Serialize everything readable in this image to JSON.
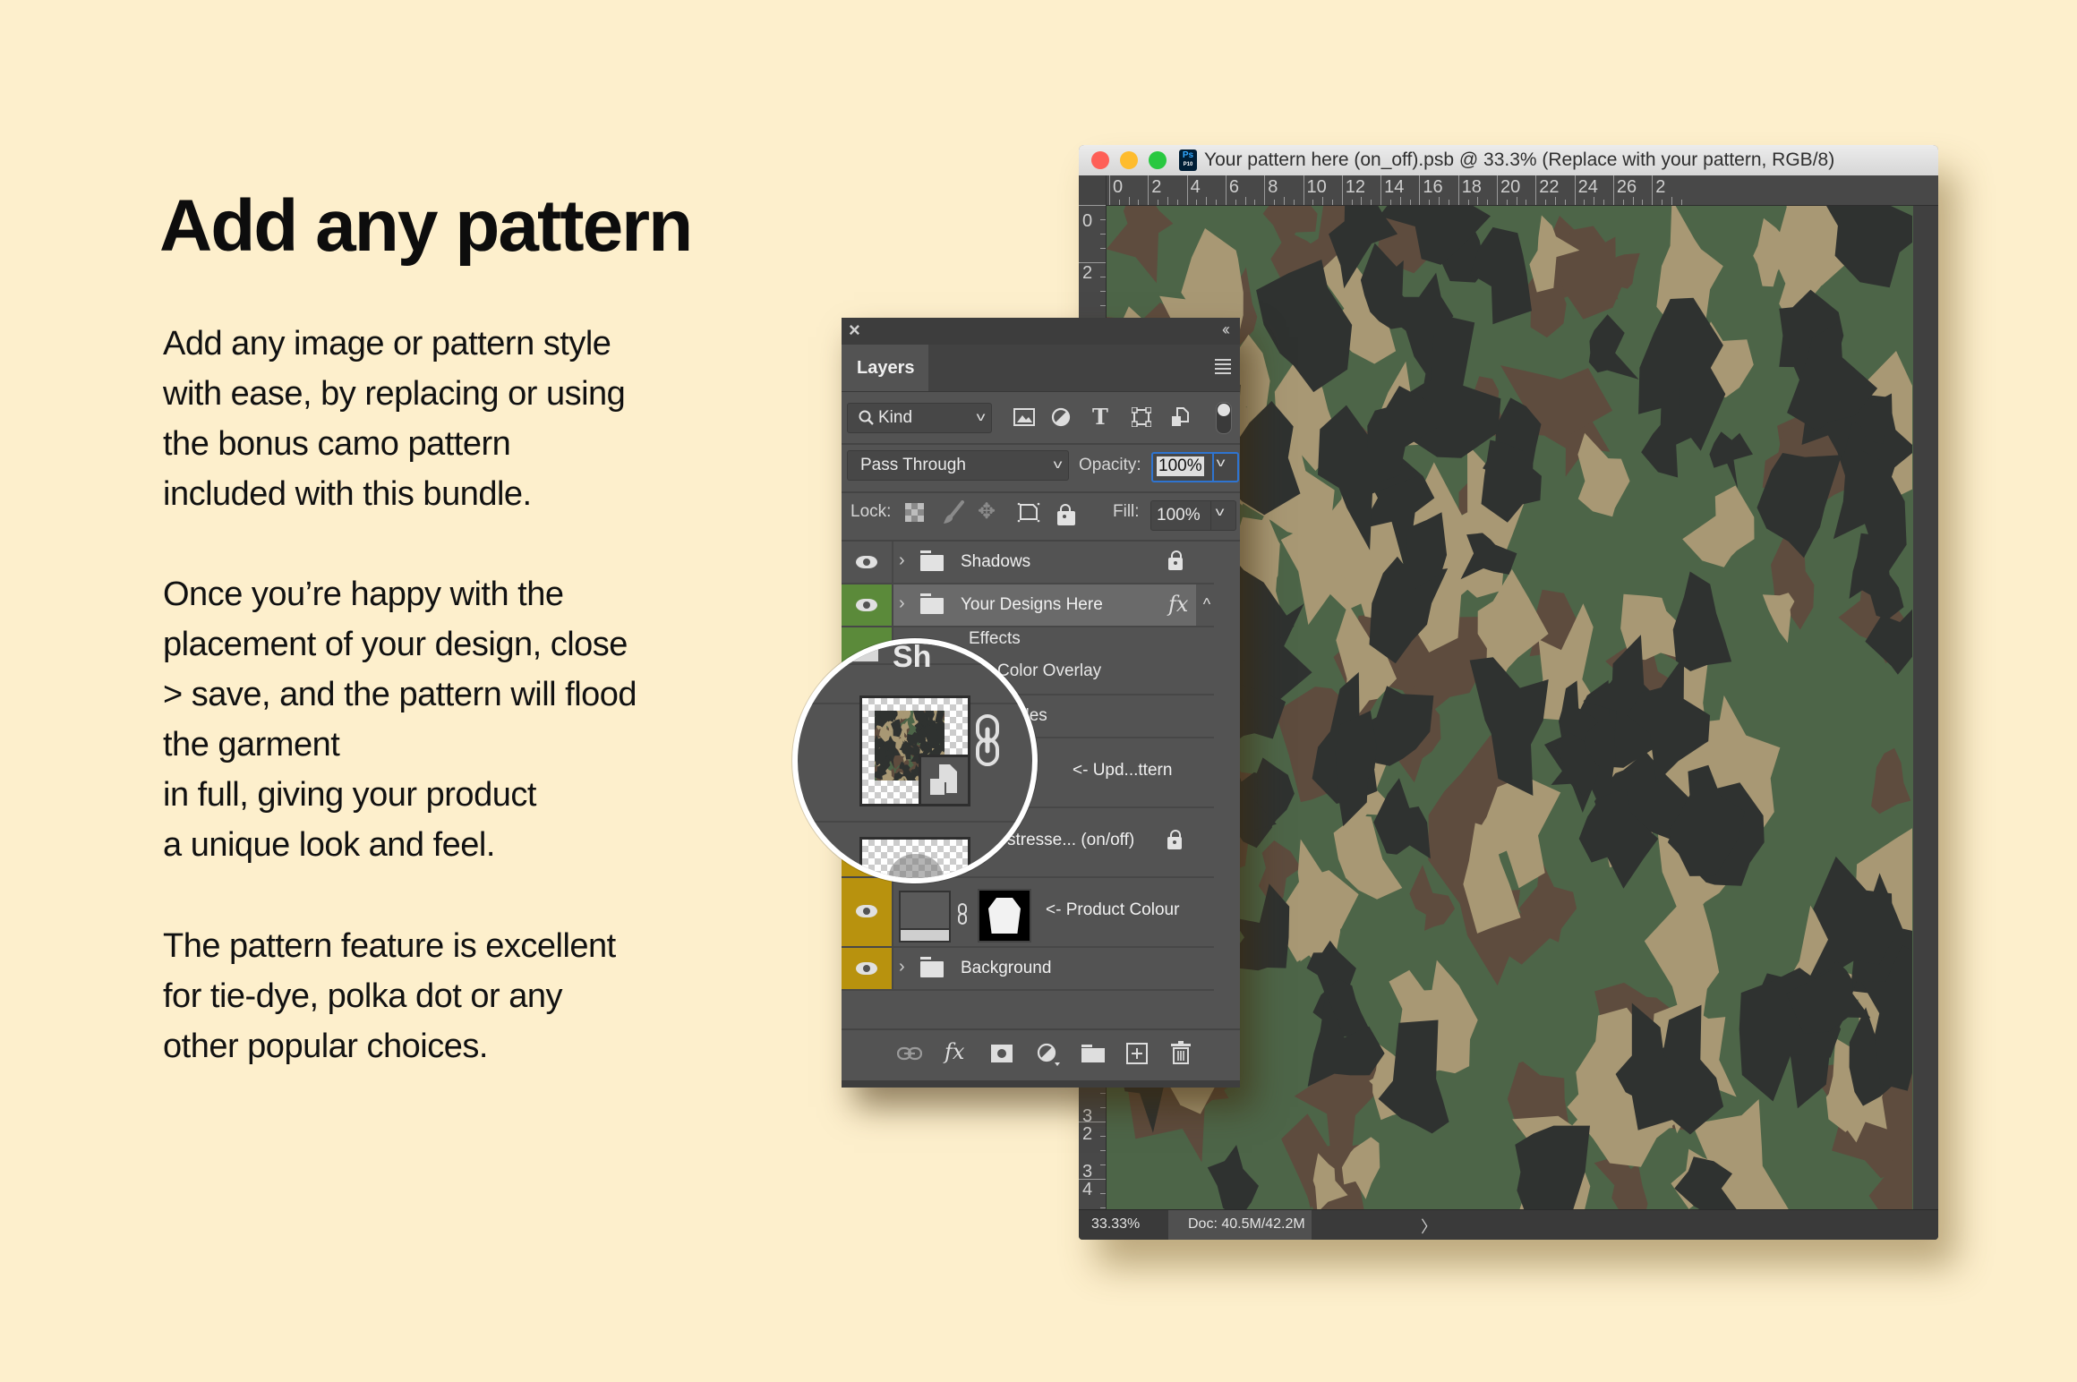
{
  "marketing": {
    "headline": "Add any pattern",
    "paragraphs": [
      "Add any image or pattern style\nwith ease, by replacing or using\nthe bonus camo pattern\nincluded with this bundle.",
      "Once you’re happy with the\nplacement of your design, close\n> save, and the pattern will flood\nthe garment\nin full, giving your product\n a unique look and feel.",
      "The pattern feature is excellent\nfor tie-dye, polka dot or any\nother popular choices."
    ]
  },
  "document_window": {
    "title": "Your pattern here (on_off).psb @ 33.3% (Replace with your pattern, RGB/8)",
    "app_badge": "Ps",
    "app_badge_sub": "P10",
    "ruler_top_labels": [
      "0",
      "2",
      "4",
      "6",
      "8",
      "10",
      "12",
      "14",
      "16",
      "18",
      "20",
      "22",
      "24",
      "26",
      "2"
    ],
    "ruler_left_labels": [
      "0",
      "2",
      "3\n2",
      "3\n4"
    ],
    "status": {
      "zoom": "33.33%",
      "doc_size": "Doc: 40.5M/42.2M",
      "arrow": "〉"
    },
    "camo_colors": {
      "green": "#4d6548",
      "brown": "#5e4c3e",
      "tan": "#a89874",
      "black": "#2f3230"
    }
  },
  "layers_panel": {
    "close_icon": "×",
    "collapse_icon": "‹‹",
    "tab_label": "Layers",
    "filter": {
      "kind_label": "Kind",
      "filter_icons": [
        "image-filter-icon",
        "adjustment-filter-icon",
        "type-filter-icon",
        "shape-filter-icon",
        "smart-object-filter-icon"
      ]
    },
    "blend_mode": "Pass Through",
    "opacity_label": "Opacity:",
    "opacity_value": "100%",
    "lock_label": "Lock:",
    "fill_label": "Fill:",
    "fill_value": "100%",
    "layers": [
      {
        "name": "Shadows",
        "type": "group",
        "locked": true,
        "color_tag": "none"
      },
      {
        "name": "Your Designs Here",
        "type": "group",
        "fx": "fx",
        "color_tag": "#5b8a3a",
        "selected": true
      },
      {
        "name": "Effects",
        "type": "effects-header"
      },
      {
        "name": "Color Overlay",
        "type": "effect"
      },
      {
        "name": "Styles",
        "type": "effect-partial",
        "visible_text": "yles"
      },
      {
        "name": "<- Upd...ttern",
        "type": "smart-object"
      },
      {
        "name": "Distresse... (on/off)",
        "type": "layer",
        "visible_text": "stresse... (on/off)",
        "locked": true
      },
      {
        "name": "<- Product Colour",
        "type": "adjustment",
        "color_tag": "#b8920e"
      },
      {
        "name": "Background",
        "type": "group",
        "color_tag": "#b8920e"
      }
    ],
    "bottom_actions": [
      "link-layers",
      "fx",
      "add-mask",
      "adjustment-layer",
      "new-group",
      "new-layer",
      "delete-layer"
    ],
    "fx_label": "fx",
    "effects_label": "Effects",
    "color_overlay_label": "Color Overlay",
    "styles_partial": "yles",
    "smart_partial": "Sh"
  }
}
